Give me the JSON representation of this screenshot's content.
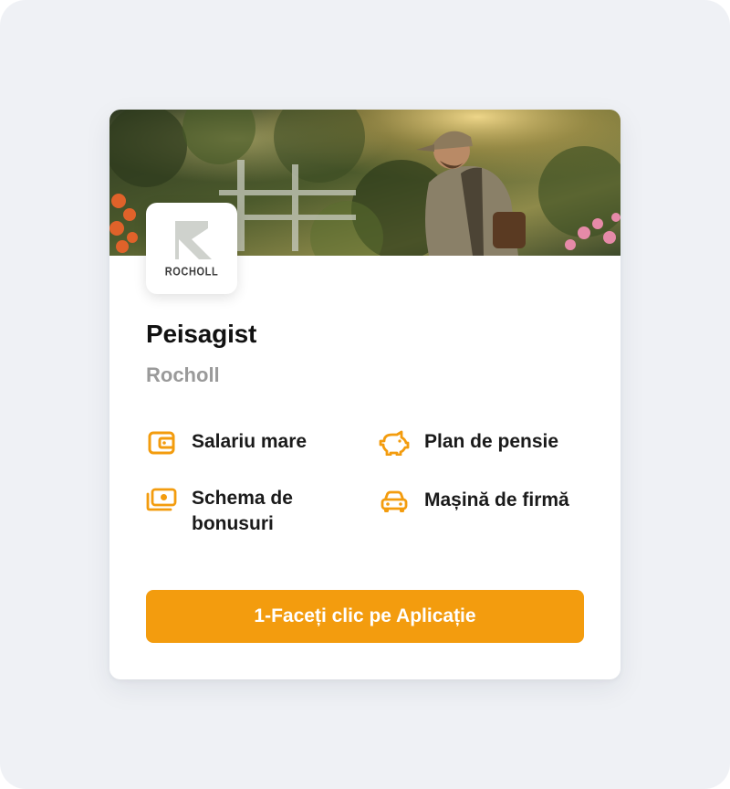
{
  "job": {
    "title": "Peisagist",
    "company": "Rocholl",
    "logo_text": "ROCHOLL",
    "hero_image": "landscaper-in-garden-photo"
  },
  "benefits": [
    {
      "icon": "wallet-icon",
      "label": "Salariu mare"
    },
    {
      "icon": "piggy-bank-icon",
      "label": "Plan de pensie"
    },
    {
      "icon": "money-bills-icon",
      "label": "Schema de bonusuri"
    },
    {
      "icon": "car-icon",
      "label": "Mașină de firmă"
    }
  ],
  "cta": {
    "label": "1-Faceți clic pe Aplicație"
  },
  "colors": {
    "accent": "#f39c0e",
    "background": "#eff1f5",
    "muted_text": "#9a9a9a"
  }
}
